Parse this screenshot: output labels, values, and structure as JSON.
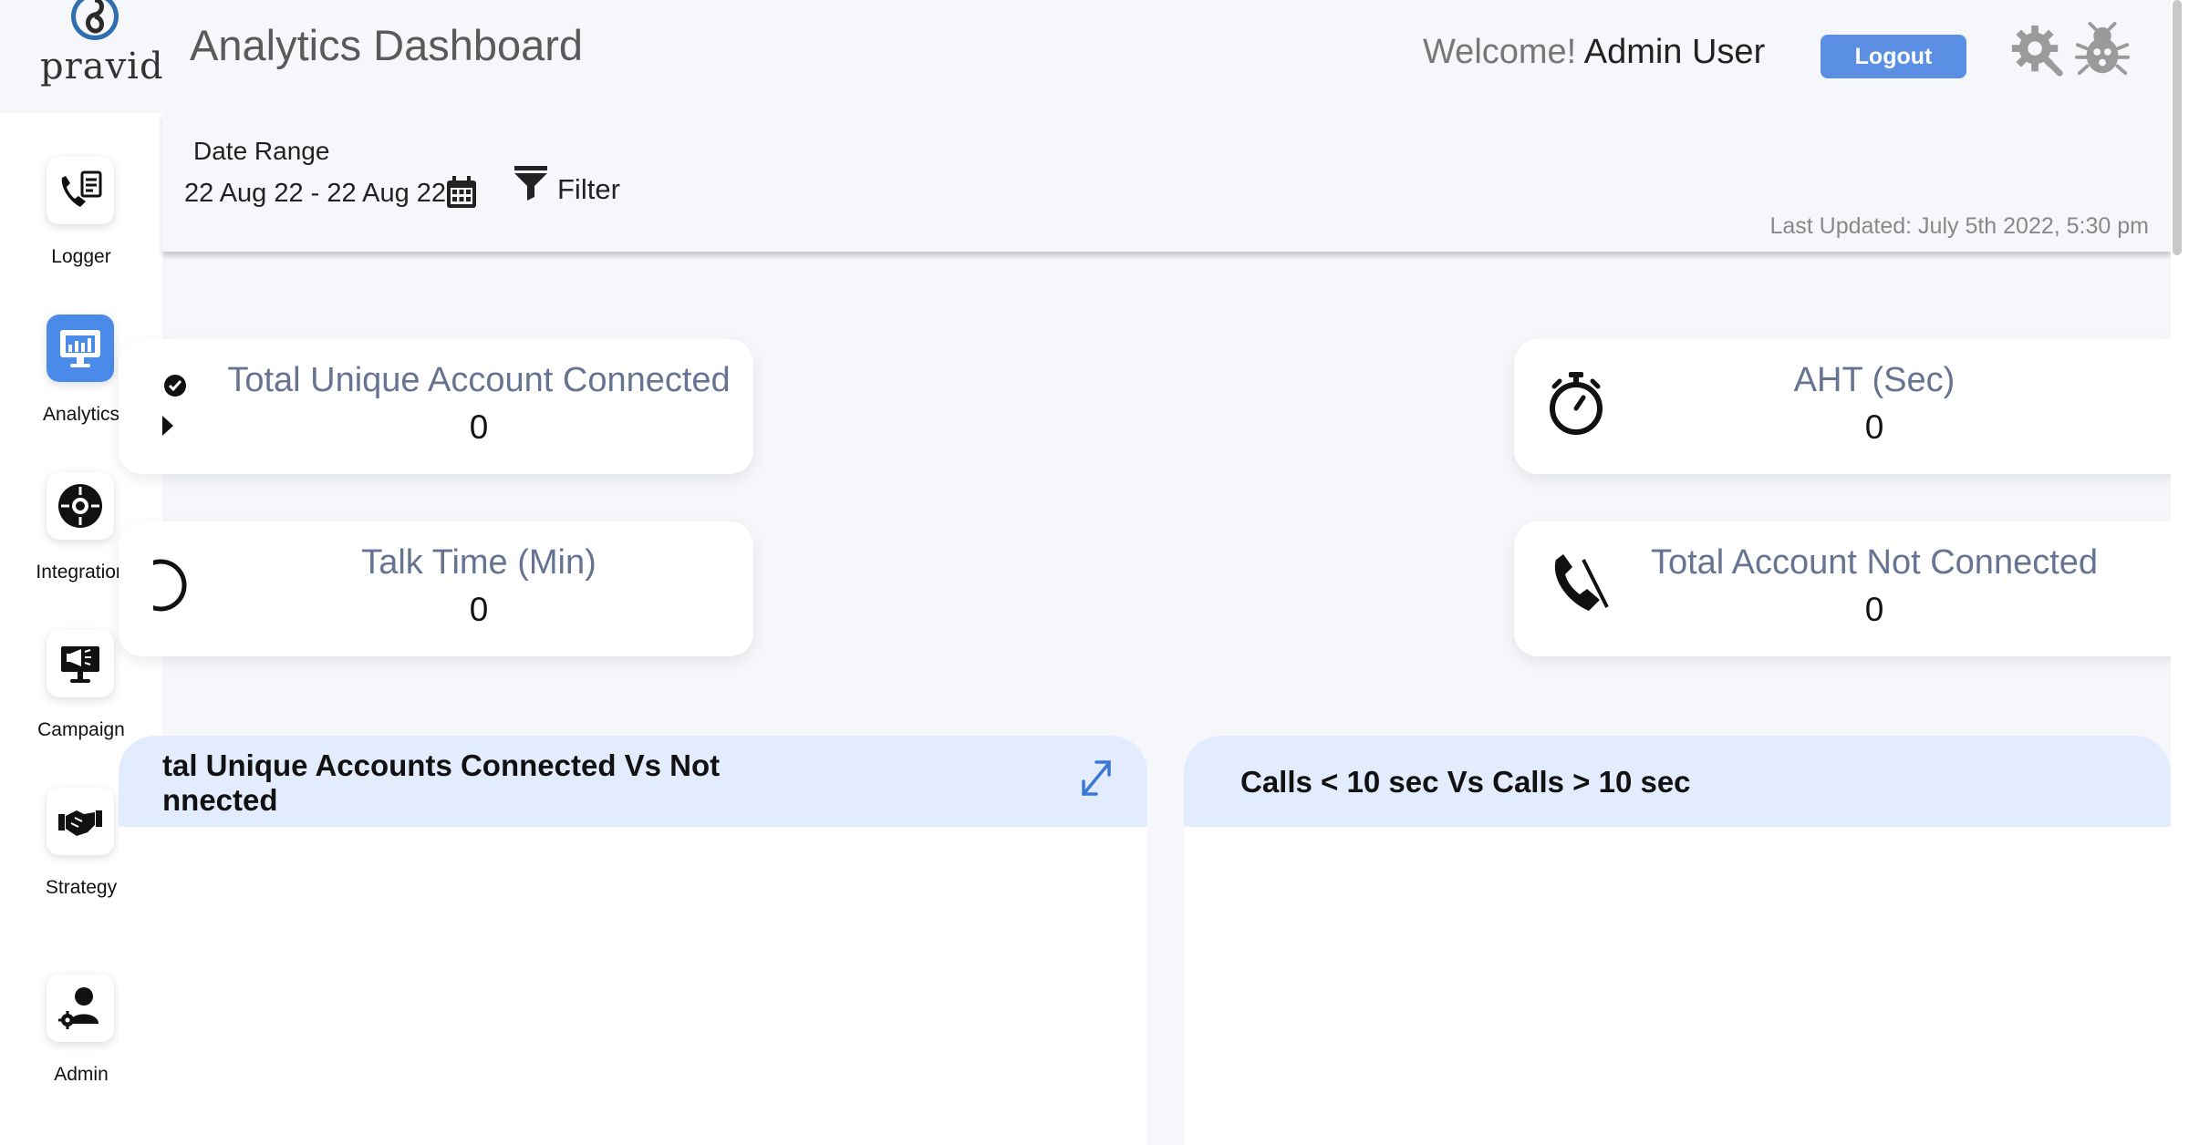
{
  "header": {
    "logo_text": "pravid",
    "title": "Analytics Dashboard",
    "welcome_prefix": "Welcome!",
    "user_name": "Admin User",
    "logout_label": "Logout",
    "settings_icon": "gear-icon",
    "bug_icon": "bug-icon"
  },
  "sidebar": {
    "items": [
      {
        "label": "Logger",
        "icon": "phone-log-icon",
        "active": false
      },
      {
        "label": "Analytics",
        "icon": "analytics-monitor-icon",
        "active": true
      },
      {
        "label": "Integration",
        "icon": "integration-hub-icon",
        "active": false
      },
      {
        "label": "Campaign",
        "icon": "campaign-megaphone-icon",
        "active": false
      },
      {
        "label": "Strategy",
        "icon": "handshake-icon",
        "active": false
      },
      {
        "label": "Admin",
        "icon": "admin-user-icon",
        "active": false
      }
    ]
  },
  "filters": {
    "date_range_label": "Date Range",
    "date_range_value": "22 Aug 22 - 22 Aug 22",
    "filter_label": "Filter",
    "last_updated": "Last Updated: July 5th 2022, 5:30 pm"
  },
  "stats": [
    {
      "title": "Total Unique Account Connected",
      "value": "0",
      "icon": "check-circle-icon"
    },
    {
      "title": "Talk Time (Min)",
      "value": "0",
      "icon": "clock-icon"
    },
    {
      "title": "AHT (Sec)",
      "value": "0",
      "icon": "stopwatch-icon"
    },
    {
      "title": "Total Account Not Connected",
      "value": "0",
      "icon": "phone-disconnected-icon"
    }
  ],
  "panels": {
    "left": {
      "title_line1": "tal Unique Accounts Connected Vs Not",
      "title_line2": "nnected"
    },
    "right": {
      "title": "Calls < 10 sec Vs Calls > 10 sec"
    }
  },
  "colors": {
    "accent": "#4a8ae8",
    "logout": "#5b8fe4",
    "card_title": "#667392",
    "panel_header": "#e2ecfc",
    "page_bg": "#f6f7fa"
  }
}
